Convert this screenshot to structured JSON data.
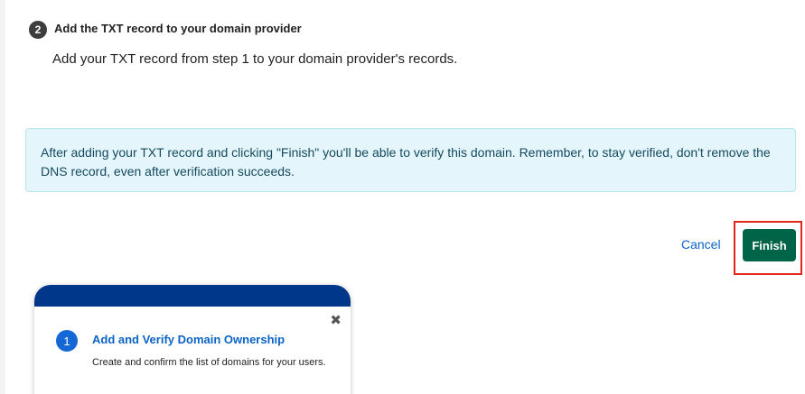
{
  "step2": {
    "number": "2",
    "title": "Add the TXT record to your domain provider",
    "description": "Add your TXT record from step 1 to your domain provider's records."
  },
  "info": {
    "message": "After adding your TXT record and clicking \"Finish\" you'll be able to verify this domain. Remember, to stay verified, don't remove the DNS record, even after verification succeeds."
  },
  "actions": {
    "cancel_label": "Cancel",
    "finish_label": "Finish"
  },
  "guide": {
    "close_glyph": "✖",
    "step_number": "1",
    "step_title": "Add and Verify Domain Ownership",
    "step_description": "Create and confirm the list of domains for your users."
  },
  "colors": {
    "finish_bg": "#006449",
    "link": "#0b63c7",
    "info_bg": "#e4f6fb",
    "guide_header": "#00378a",
    "highlight": "#e2261c"
  }
}
